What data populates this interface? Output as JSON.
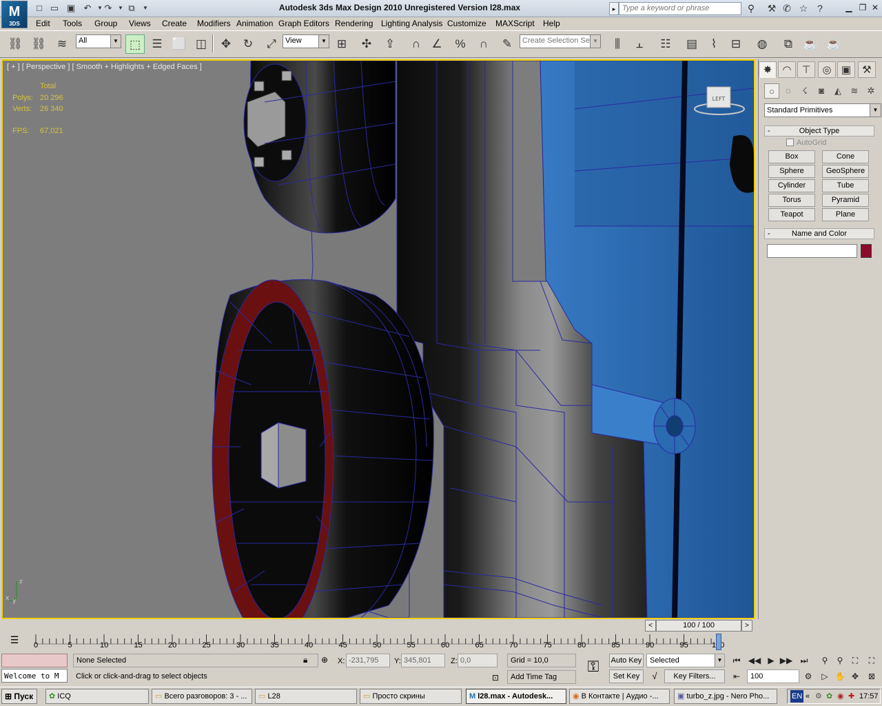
{
  "window": {
    "title": "Autodesk 3ds Max Design 2010    Unregistered Version      l28.max",
    "logo_text": "M",
    "logo_sub": "3DS",
    "search_placeholder": "Type a keyword or phrase"
  },
  "menu": [
    "Edit",
    "Tools",
    "Group",
    "Views",
    "Create",
    "Modifiers",
    "Animation",
    "Graph Editors",
    "Rendering",
    "Lighting Analysis",
    "Customize",
    "MAXScript",
    "Help"
  ],
  "toolbar": {
    "filter_value": "All",
    "refcoord_value": "View",
    "selection_set_placeholder": "Create Selection Se"
  },
  "viewport": {
    "label": "[ + ] [ Perspective ] [ Smooth + Highlights + Edged Faces ]",
    "stats": {
      "header": "Total",
      "polys_label": "Polys:",
      "polys_value": "20 296",
      "verts_label": "Verts:",
      "verts_value": "26 340",
      "fps_label": "FPS:",
      "fps_value": "67,021"
    },
    "viewcube_label": "LEFT",
    "axis_z": "z",
    "axis_x": "x",
    "axis_y": "y",
    "colors": {
      "background": "#7f7f7f",
      "blue_part": "#2f6fb6",
      "wire": "#2a2aa0",
      "red_ring": "#6a1010",
      "active_border": "#f0d000"
    }
  },
  "command_panel": {
    "category": "Standard Primitives",
    "object_type_title": "Object Type",
    "autogrid_label": "AutoGrid",
    "primitives": [
      "Box",
      "Cone",
      "Sphere",
      "GeoSphere",
      "Cylinder",
      "Tube",
      "Torus",
      "Pyramid",
      "Teapot",
      "Plane"
    ],
    "name_color_title": "Name and Color",
    "object_color": "#8a0a2a"
  },
  "timeline": {
    "position": "100 / 100",
    "prev": "<",
    "next": ">",
    "ticks": [
      "0",
      "5",
      "10",
      "15",
      "20",
      "25",
      "30",
      "35",
      "40",
      "45",
      "50",
      "55",
      "60",
      "65",
      "70",
      "75",
      "80",
      "85",
      "90",
      "95",
      "100"
    ]
  },
  "status": {
    "welcome": "Welcome to M",
    "selection": "None Selected",
    "prompt": "Click or click-and-drag to select objects",
    "x_label": "X:",
    "x_value": "-231,795",
    "y_label": "Y:",
    "y_value": "345,801",
    "z_label": "Z:",
    "z_value": "0,0",
    "grid": "Grid = 10,0",
    "add_time_tag": "Add Time Tag",
    "auto_key": "Auto Key",
    "set_key": "Set Key",
    "key_mode": "Selected",
    "key_filters": "Key Filters...",
    "frame": "100"
  },
  "taskbar": {
    "start": "Пуск",
    "tasks": [
      "ICQ",
      "Всего разговоров: 3 - ...",
      "L28",
      "Просто скрины",
      "l28.max - Autodesk...",
      "В Контакте | Аудио -...",
      "turbo_z.jpg - Nero Pho..."
    ],
    "lang": "EN",
    "clock": "17:57"
  }
}
